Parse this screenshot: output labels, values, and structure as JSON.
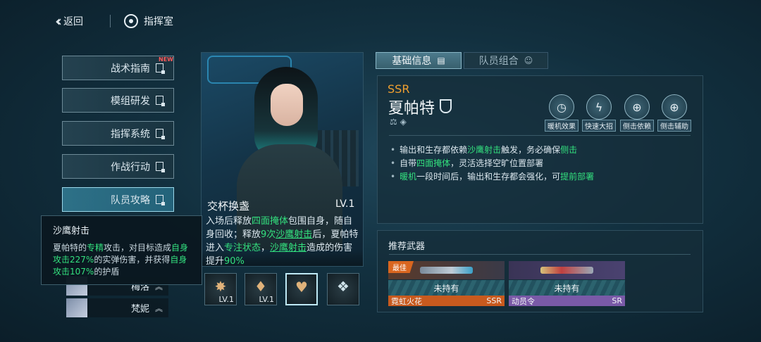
{
  "topbar": {
    "back_label": "返回",
    "command_label": "指挥室"
  },
  "menu": {
    "items": [
      {
        "label": "战术指南"
      },
      {
        "label": "模组研发"
      },
      {
        "label": "指挥系统"
      },
      {
        "label": "作战行动"
      },
      {
        "label": "队员攻略"
      }
    ],
    "new_badge": "NEW"
  },
  "roster": {
    "items": [
      {
        "name": "梅洛"
      },
      {
        "name": "梵妮"
      }
    ]
  },
  "tooltip": {
    "title": "沙鹰射击",
    "segments": [
      {
        "text": "夏帕特的",
        "hl": false
      },
      {
        "text": "专精",
        "hl": true
      },
      {
        "text": "攻击，对目标造成",
        "hl": false
      },
      {
        "text": "自身攻击227%",
        "hl": true
      },
      {
        "text": "的实弹伤害，并获得",
        "hl": false
      },
      {
        "text": "自身攻击107%",
        "hl": true
      },
      {
        "text": "的护盾",
        "hl": false
      }
    ]
  },
  "skill": {
    "name": "交杯换盏",
    "level": "LV.1",
    "segments": [
      {
        "text": "入场后释放",
        "hl": false
      },
      {
        "text": "四面掩体",
        "hl": true
      },
      {
        "text": "包围自身，随自身回收；释放",
        "hl": false
      },
      {
        "text": "9次",
        "hl": true
      },
      {
        "text": "沙鹰射击",
        "hl": true,
        "u": true
      },
      {
        "text": "后，夏帕特进入",
        "hl": false
      },
      {
        "text": "专注状态",
        "hl": true
      },
      {
        "text": "，",
        "hl": false
      },
      {
        "text": "沙鹰射击",
        "hl": true,
        "u": true
      },
      {
        "text": "造成的伤害提升",
        "hl": false
      },
      {
        "text": "90%",
        "hl": true
      }
    ],
    "icons": [
      {
        "icon": "burst-icon",
        "level": "LV.1"
      },
      {
        "icon": "flame-icon",
        "level": "LV.1"
      },
      {
        "icon": "heart-shield-icon",
        "level": ""
      },
      {
        "icon": "cube-icon",
        "level": ""
      }
    ]
  },
  "tabs": [
    {
      "label": "基础信息"
    },
    {
      "label": "队员组合"
    }
  ],
  "character": {
    "rarity": "SSR",
    "name": "夏帕特",
    "tags": [
      {
        "label": "暖机效果",
        "icon": "gauge-icon"
      },
      {
        "label": "快速大招",
        "icon": "lightning-icon"
      },
      {
        "label": "侧击依赖",
        "icon": "crosshair-left-icon"
      },
      {
        "label": "侧击辅助",
        "icon": "crosshair-plus-icon"
      }
    ],
    "bullets": [
      [
        {
          "text": "输出和生存都依赖",
          "hl": false
        },
        {
          "text": "沙鹰射击",
          "hl": true
        },
        {
          "text": "触发，务必确保",
          "hl": false
        },
        {
          "text": "侧击",
          "hl": true
        }
      ],
      [
        {
          "text": "自带",
          "hl": false
        },
        {
          "text": "四面掩体",
          "hl": true
        },
        {
          "text": "，灵活选择空旷位置部署",
          "hl": false
        }
      ],
      [
        {
          "text": "暖机",
          "hl": true
        },
        {
          "text": "一段时间后，输出和生存都会强化，可",
          "hl": false
        },
        {
          "text": "提前部署",
          "hl": true
        }
      ]
    ]
  },
  "weapons": {
    "title": "推荐武器",
    "items": [
      {
        "badge": "最佳",
        "status": "未持有",
        "name": "霓虹火花",
        "rarity": "SSR",
        "color": "#c85a1e"
      },
      {
        "badge": "",
        "status": "未持有",
        "name": "动员令",
        "rarity": "SR",
        "color": "#7a5aa8"
      }
    ]
  },
  "colors": {
    "highlight": "#33e07e",
    "ssr": "#f0a030",
    "accent": "#4c7a8c"
  }
}
